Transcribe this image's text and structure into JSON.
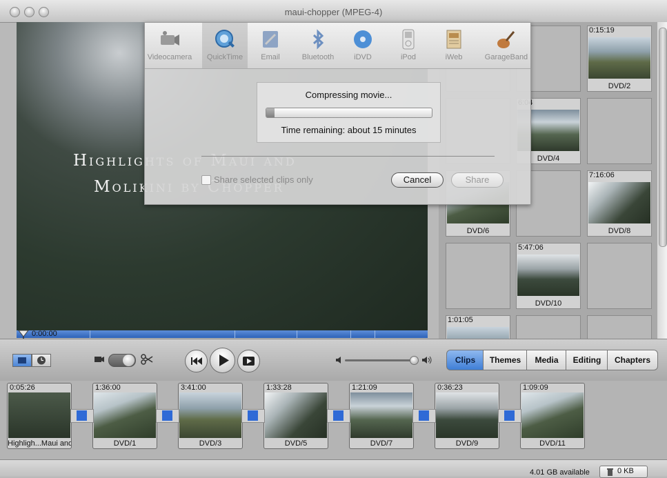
{
  "window": {
    "title": "maui-chopper (MPEG-4)"
  },
  "viewer": {
    "title_line1": "Highlights of Maui and",
    "title_line2": "Molikini by Chopper",
    "timecode": "0:00:00"
  },
  "share_dialog": {
    "tabs": [
      "Videocamera",
      "QuickTime",
      "Email",
      "Bluetooth",
      "iDVD",
      "iPod",
      "iWeb",
      "GarageBand"
    ],
    "selected_tab": "QuickTime",
    "progress": {
      "title": "Compressing movie...",
      "percent": 5,
      "time_remaining": "Time remaining: about 15 minutes"
    },
    "share_selected_label": "Share selected clips only",
    "share_selected_checked": false,
    "cancel_label": "Cancel",
    "share_label": "Share"
  },
  "clips_pane": {
    "cells": [
      {
        "duration": "",
        "name": ""
      },
      {
        "duration": "",
        "name": ""
      },
      {
        "duration": "0:15:19",
        "name": "DVD/2"
      },
      {
        "duration": "",
        "name": ""
      },
      {
        "duration": "6:04",
        "name": "DVD/4"
      },
      {
        "duration": "",
        "name": ""
      },
      {
        "duration": "",
        "name": "DVD/6"
      },
      {
        "duration": "",
        "name": ""
      },
      {
        "duration": "7:16:06",
        "name": "DVD/8"
      },
      {
        "duration": "",
        "name": ""
      },
      {
        "duration": "5:47:06",
        "name": "DVD/10"
      },
      {
        "duration": "",
        "name": ""
      },
      {
        "duration": "1:01:05",
        "name": ""
      },
      {
        "duration": "",
        "name": ""
      },
      {
        "duration": "",
        "name": ""
      }
    ]
  },
  "toolbar": {
    "tabs": [
      "Clips",
      "Themes",
      "Media",
      "Editing",
      "Chapters"
    ],
    "selected_tab": "Clips",
    "volume": 0.97
  },
  "timeline": {
    "clips": [
      {
        "duration": "0:05:26",
        "name": "Highligh...Maui and"
      },
      {
        "duration": "1:36:00",
        "name": "DVD/1"
      },
      {
        "duration": "3:41:00",
        "name": "DVD/3"
      },
      {
        "duration": "1:33:28",
        "name": "DVD/5"
      },
      {
        "duration": "1:21:09",
        "name": "DVD/7"
      },
      {
        "duration": "0:36:23",
        "name": "DVD/9"
      },
      {
        "duration": "1:09:09",
        "name": "DVD/11"
      }
    ]
  },
  "status": {
    "available": "4.01 GB available",
    "trash": "0 KB"
  },
  "colors": {
    "accent": "#3f7fd6",
    "scrubber": "#2d62b8"
  }
}
